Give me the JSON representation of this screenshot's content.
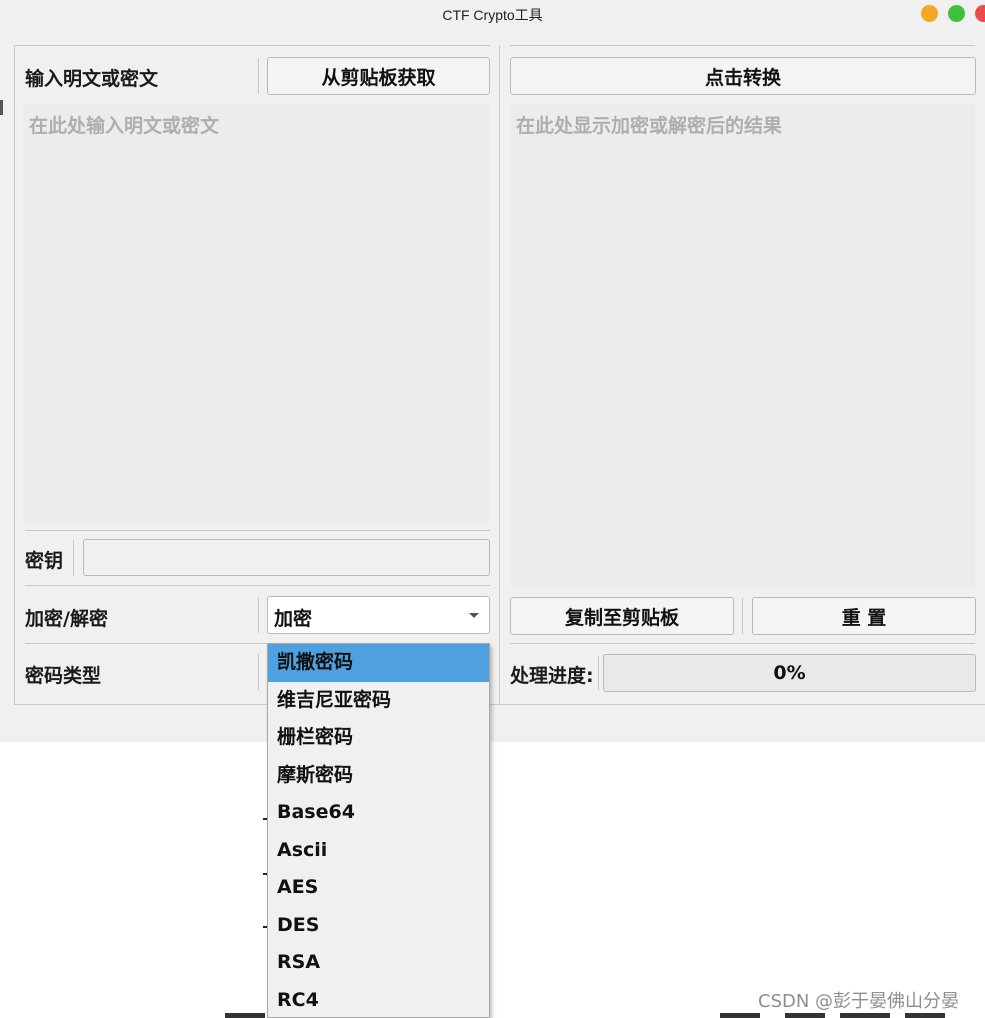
{
  "window": {
    "title": "CTF Crypto工具"
  },
  "input_panel": {
    "label": "输入明文或密文",
    "clipboard_button": "从剪贴板获取",
    "placeholder": "在此处输入明文或密文",
    "value": ""
  },
  "output_panel": {
    "convert_button": "点击转换",
    "placeholder": "在此处显示加密或解密后的结果",
    "value": ""
  },
  "key": {
    "label": "密钥",
    "value": ""
  },
  "mode": {
    "label": "加密/解密",
    "selected": "加密"
  },
  "cipher_type": {
    "label": "密码类型",
    "options": [
      "凯撒密码",
      "维吉尼亚密码",
      "栅栏密码",
      "摩斯密码",
      "Base64",
      "Ascii",
      "AES",
      "DES",
      "RSA",
      "RC4"
    ],
    "highlighted_index": 0
  },
  "actions": {
    "copy_button": "复制至剪贴板",
    "reset_button": "重 置"
  },
  "progress": {
    "label": "处理进度:",
    "value_text": "0%",
    "fraction": 0.0
  },
  "watermark": "CSDN @彭于晏佛山分晏",
  "colors": {
    "highlight": "#4ea0df",
    "window_bg": "#f0f0f0"
  }
}
